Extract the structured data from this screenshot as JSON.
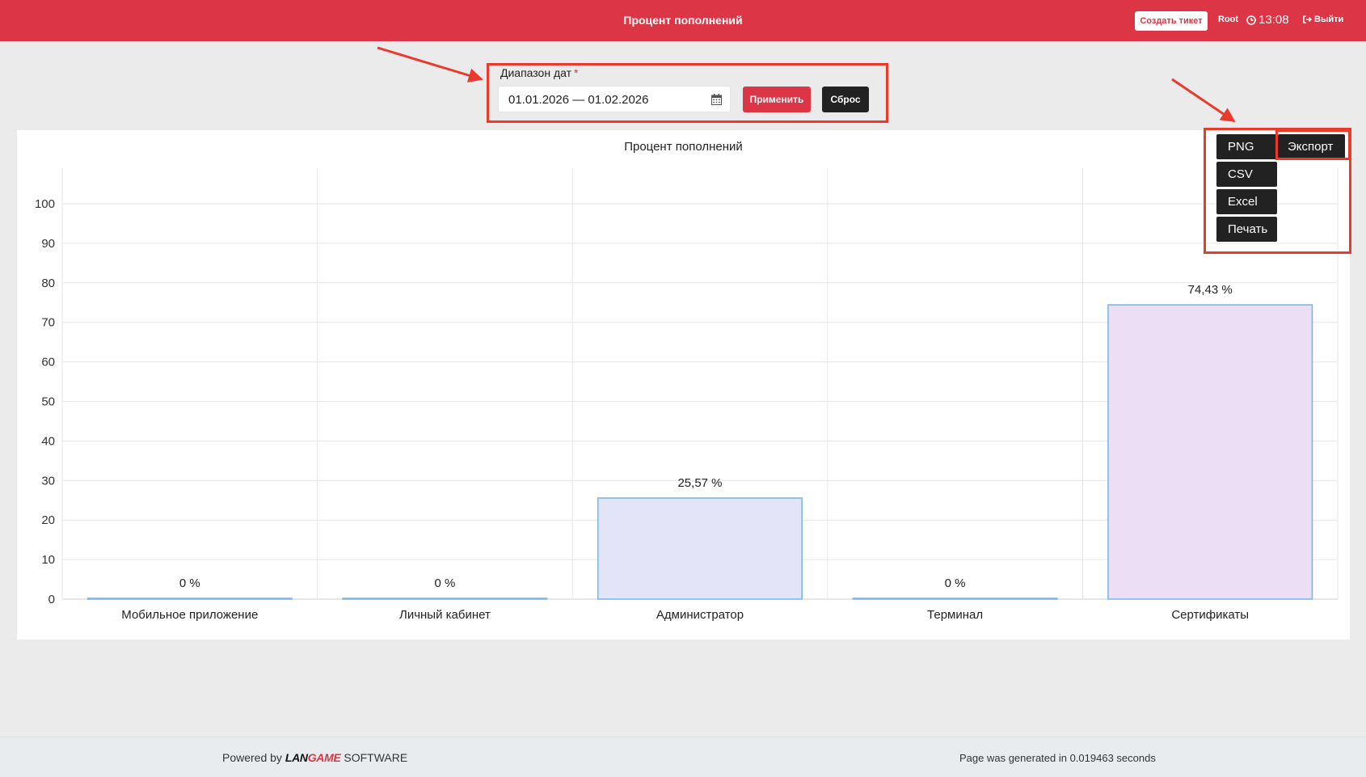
{
  "header": {
    "title": "Процент пополнений",
    "ticket_button": "Создать тикет",
    "user": "Root",
    "time": "13:08",
    "logout": "Выйти"
  },
  "filter": {
    "label": "Диапазон дат",
    "required_mark": "*",
    "date_range": "01.01.2026 — 01.02.2026",
    "apply_label": "Применить",
    "reset_label": "Сброс"
  },
  "export": {
    "button_label": "Экспорт",
    "options": [
      "PNG",
      "CSV",
      "Excel",
      "Печать"
    ]
  },
  "chart_data": {
    "type": "bar",
    "title": "Процент пополнений",
    "categories": [
      "Мобильное приложение",
      "Личный кабинет",
      "Администратор",
      "Терминал",
      "Сертификаты"
    ],
    "values": [
      0,
      0,
      25.57,
      0,
      74.43
    ],
    "value_labels": [
      "0 %",
      "0 %",
      "25,57 %",
      "0 %",
      "74,43 %"
    ],
    "bar_colors": [
      "#e3e4f7",
      "#e3e4f7",
      "#e3e4f7",
      "#e3e4f7",
      "#ecdff5"
    ],
    "bar_border_color": "#7bb8e8",
    "ylim": [
      0,
      100
    ],
    "yticks": [
      0,
      10,
      20,
      30,
      40,
      50,
      60,
      70,
      80,
      90,
      100
    ],
    "grid": true
  },
  "footer": {
    "powered_by": "Powered by",
    "logo_lan": "LAN",
    "logo_game": "GAME",
    "software": "SOFTWARE",
    "generated": "Page was generated in 0.019463 seconds"
  },
  "colors": {
    "brand": "#dc3545",
    "dark_button": "#222222",
    "annotation": "#ea3a2c"
  }
}
